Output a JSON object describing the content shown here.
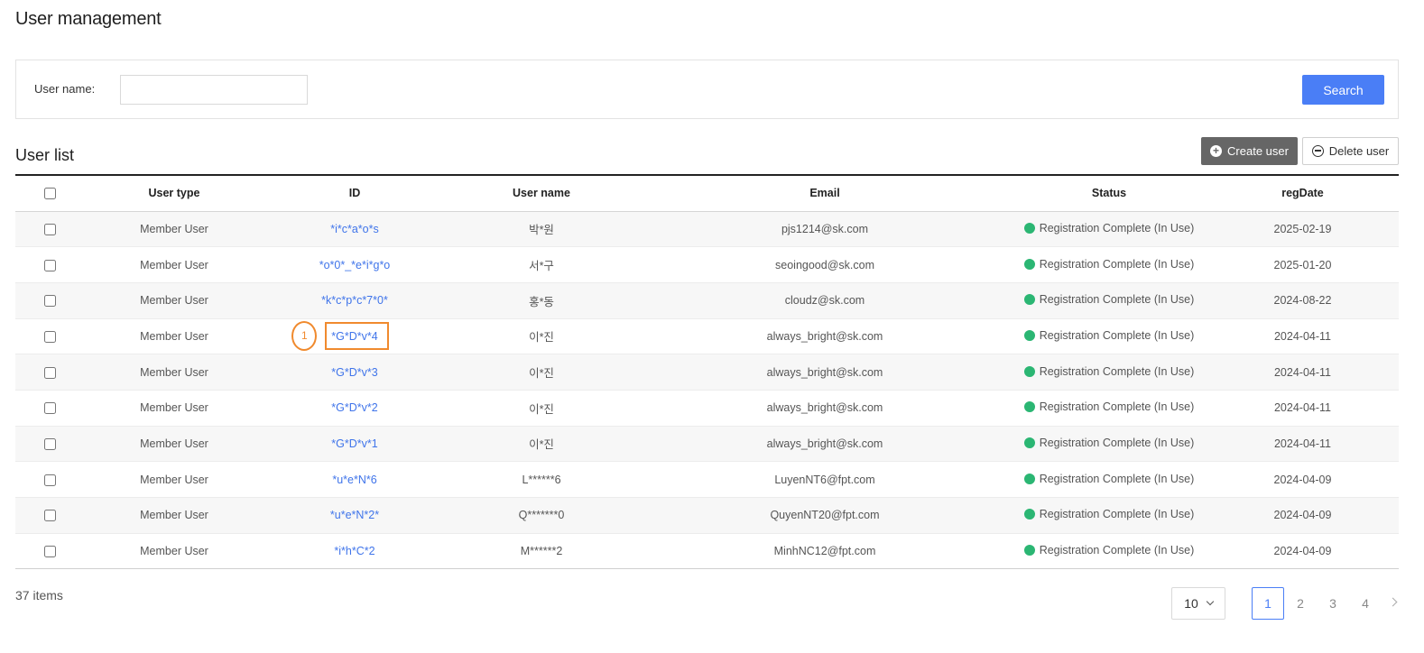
{
  "page": {
    "title": "User management"
  },
  "search": {
    "label": "User name:",
    "value": "",
    "placeholder": "",
    "button_label": "Search"
  },
  "user_list": {
    "title": "User list",
    "create_label": "Create user",
    "delete_label": "Delete user",
    "columns": [
      "User type",
      "ID",
      "User name",
      "Email",
      "Status",
      "regDate"
    ],
    "rows": [
      {
        "type": "Member User",
        "id": "*i*c*a*o*s",
        "name": "박*원",
        "email": "pjs1214@sk.com",
        "status": "Registration Complete (In Use)",
        "regDate": "2025-02-19"
      },
      {
        "type": "Member User",
        "id": "*o*0*_*e*i*g*o",
        "name": "서*구",
        "email": "seoingood@sk.com",
        "status": "Registration Complete (In Use)",
        "regDate": "2025-01-20"
      },
      {
        "type": "Member User",
        "id": "*k*c*p*c*7*0*",
        "name": "홍*동",
        "email": "cloudz@sk.com",
        "status": "Registration Complete (In Use)",
        "regDate": "2024-08-22"
      },
      {
        "type": "Member User",
        "id": "*G*D*v*4",
        "name": "이*진",
        "email": "always_bright@sk.com",
        "status": "Registration Complete (In Use)",
        "regDate": "2024-04-11"
      },
      {
        "type": "Member User",
        "id": "*G*D*v*3",
        "name": "이*진",
        "email": "always_bright@sk.com",
        "status": "Registration Complete (In Use)",
        "regDate": "2024-04-11"
      },
      {
        "type": "Member User",
        "id": "*G*D*v*2",
        "name": "이*진",
        "email": "always_bright@sk.com",
        "status": "Registration Complete (In Use)",
        "regDate": "2024-04-11"
      },
      {
        "type": "Member User",
        "id": "*G*D*v*1",
        "name": "이*진",
        "email": "always_bright@sk.com",
        "status": "Registration Complete (In Use)",
        "regDate": "2024-04-11"
      },
      {
        "type": "Member User",
        "id": "*u*e*N*6",
        "name": "L******6",
        "email": "LuyenNT6@fpt.com",
        "status": "Registration Complete (In Use)",
        "regDate": "2024-04-09"
      },
      {
        "type": "Member User",
        "id": "*u*e*N*2*",
        "name": "Q*******0",
        "email": "QuyenNT20@fpt.com",
        "status": "Registration Complete (In Use)",
        "regDate": "2024-04-09"
      },
      {
        "type": "Member User",
        "id": "*i*h*C*2",
        "name": "M******2",
        "email": "MinhNC12@fpt.com",
        "status": "Registration Complete (In Use)",
        "regDate": "2024-04-09"
      }
    ],
    "status_color": "#2bb673",
    "link_color": "#3f74ea"
  },
  "annotation": {
    "marker_label": "1",
    "highlight_color": "#f08a2e"
  },
  "footer": {
    "items_count": "37 items",
    "page_size": "10",
    "pages": [
      "1",
      "2",
      "3",
      "4"
    ],
    "current_page": "1"
  },
  "colors": {
    "primary": "#4a7ef6",
    "create_button": "#666666"
  },
  "icons": {
    "create": "plus-circle-icon",
    "delete": "minus-circle-icon",
    "page_size": "chevron-down-icon",
    "next": "chevron-right-icon",
    "status": "status-dot-icon"
  }
}
